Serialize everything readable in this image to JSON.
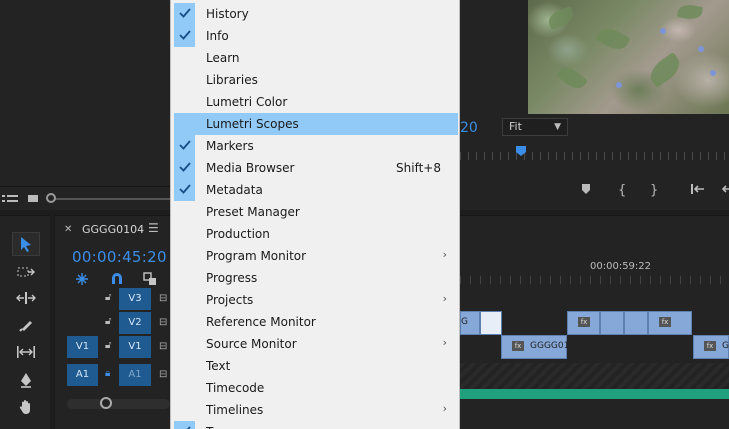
{
  "colors": {
    "accent_blue": "#3a8ee8",
    "menu_background": "#f0f0f0",
    "menu_highlight": "#91c9f7",
    "track_target_blue": "#1f5a90",
    "clip_blue": "#86a8d8",
    "audio_green": "#20a07c"
  },
  "menu": {
    "items": [
      {
        "label": "History",
        "checked": true,
        "highlighted": false,
        "shortcut": "",
        "submenu": false
      },
      {
        "label": "Info",
        "checked": true,
        "highlighted": false,
        "shortcut": "",
        "submenu": false
      },
      {
        "label": "Learn",
        "checked": false,
        "highlighted": false,
        "shortcut": "",
        "submenu": false
      },
      {
        "label": "Libraries",
        "checked": false,
        "highlighted": false,
        "shortcut": "",
        "submenu": false
      },
      {
        "label": "Lumetri Color",
        "checked": false,
        "highlighted": false,
        "shortcut": "",
        "submenu": false
      },
      {
        "label": "Lumetri Scopes",
        "checked": false,
        "highlighted": true,
        "shortcut": "",
        "submenu": false
      },
      {
        "label": "Markers",
        "checked": true,
        "highlighted": false,
        "shortcut": "",
        "submenu": false
      },
      {
        "label": "Media Browser",
        "checked": true,
        "highlighted": false,
        "shortcut": "Shift+8",
        "submenu": false
      },
      {
        "label": "Metadata",
        "checked": true,
        "highlighted": false,
        "shortcut": "",
        "submenu": false
      },
      {
        "label": "Preset Manager",
        "checked": false,
        "highlighted": false,
        "shortcut": "",
        "submenu": false
      },
      {
        "label": "Production",
        "checked": false,
        "highlighted": false,
        "shortcut": "",
        "submenu": false
      },
      {
        "label": "Program Monitor",
        "checked": false,
        "highlighted": false,
        "shortcut": "",
        "submenu": true
      },
      {
        "label": "Progress",
        "checked": false,
        "highlighted": false,
        "shortcut": "",
        "submenu": false
      },
      {
        "label": "Projects",
        "checked": false,
        "highlighted": false,
        "shortcut": "",
        "submenu": true
      },
      {
        "label": "Reference Monitor",
        "checked": false,
        "highlighted": false,
        "shortcut": "",
        "submenu": false
      },
      {
        "label": "Source Monitor",
        "checked": false,
        "highlighted": false,
        "shortcut": "",
        "submenu": true
      },
      {
        "label": "Text",
        "checked": false,
        "highlighted": false,
        "shortcut": "",
        "submenu": false
      },
      {
        "label": "Timecode",
        "checked": false,
        "highlighted": false,
        "shortcut": "",
        "submenu": false
      },
      {
        "label": "Timelines",
        "checked": false,
        "highlighted": false,
        "shortcut": "",
        "submenu": true
      },
      {
        "label": "To",
        "checked": true,
        "highlighted": false,
        "shortcut": "",
        "submenu": false
      }
    ]
  },
  "program_monitor": {
    "timecode_partial": "20",
    "fit_value": "Fit"
  },
  "timeline": {
    "sequence_name": "GGGG0104",
    "timecode": "00:00:45:20",
    "ruler_time": "00:00:59:22",
    "tracks": [
      {
        "target": "",
        "id": "V3"
      },
      {
        "target": "",
        "id": "V2"
      },
      {
        "target": "V1",
        "id": "V1"
      },
      {
        "target": "A1",
        "id": "A1"
      }
    ],
    "clips": [
      {
        "name": "G"
      },
      {
        "name": "GGGG01"
      },
      {
        "name": "G"
      }
    ]
  }
}
